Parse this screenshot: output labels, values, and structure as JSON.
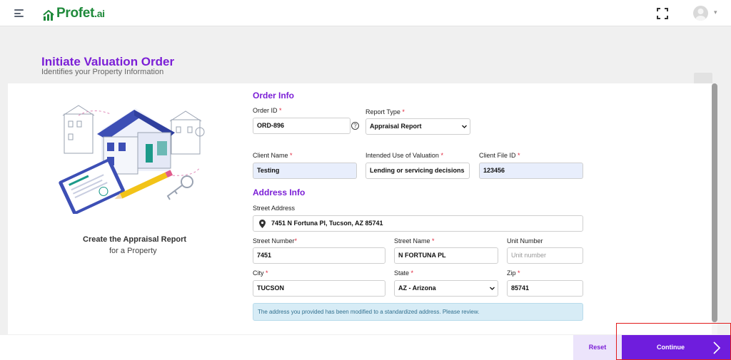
{
  "app": {
    "logo_main": "Profet",
    "logo_suffix": ".ai"
  },
  "page": {
    "title": "Initiate Valuation Order",
    "subtitle": "Identifies your Property Information"
  },
  "illustration": {
    "title": "Create the Appraisal Report",
    "subtitle": "for a Property"
  },
  "order_info": {
    "heading": "Order Info",
    "order_id": {
      "label": "Order ID",
      "value": "ORD-896"
    },
    "report_type": {
      "label": "Report Type",
      "value": "Appraisal Report"
    },
    "client_name": {
      "label": "Client Name",
      "value": "Testing"
    },
    "intended_use": {
      "label": "Intended Use of Valuation",
      "value": "Lending or servicing decisions"
    },
    "client_file_id": {
      "label": "Client File ID",
      "value": "123456"
    }
  },
  "address_info": {
    "heading": "Address Info",
    "street_address": {
      "label": "Street Address",
      "value": "7451 N Fortuna Pl, Tucson, AZ 85741"
    },
    "street_number": {
      "label": "Street Number",
      "value": "7451"
    },
    "street_name": {
      "label": "Street Name",
      "value": "N FORTUNA PL"
    },
    "unit_number": {
      "label": "Unit Number",
      "placeholder": "Unit number"
    },
    "city": {
      "label": "City",
      "value": "TUCSON"
    },
    "state": {
      "label": "State",
      "value": "AZ - Arizona"
    },
    "zip": {
      "label": "Zip",
      "value": "85741"
    },
    "notice": "The address you provided has been modified to a standardized address. Please review."
  },
  "footer": {
    "reset_label": "Reset",
    "continue_label": "Continue"
  },
  "colors": {
    "accent": "#7b1fd6",
    "brand_green": "#1f8a3b",
    "primary_button": "#6f1ddd",
    "highlight": "#e21b1b"
  },
  "icons": [
    "hamburger-menu-icon",
    "logo-chart-icon",
    "fullscreen-icon",
    "user-avatar-icon",
    "chevron-down-icon",
    "help-icon",
    "map-pin-icon",
    "chevron-right-icon"
  ]
}
